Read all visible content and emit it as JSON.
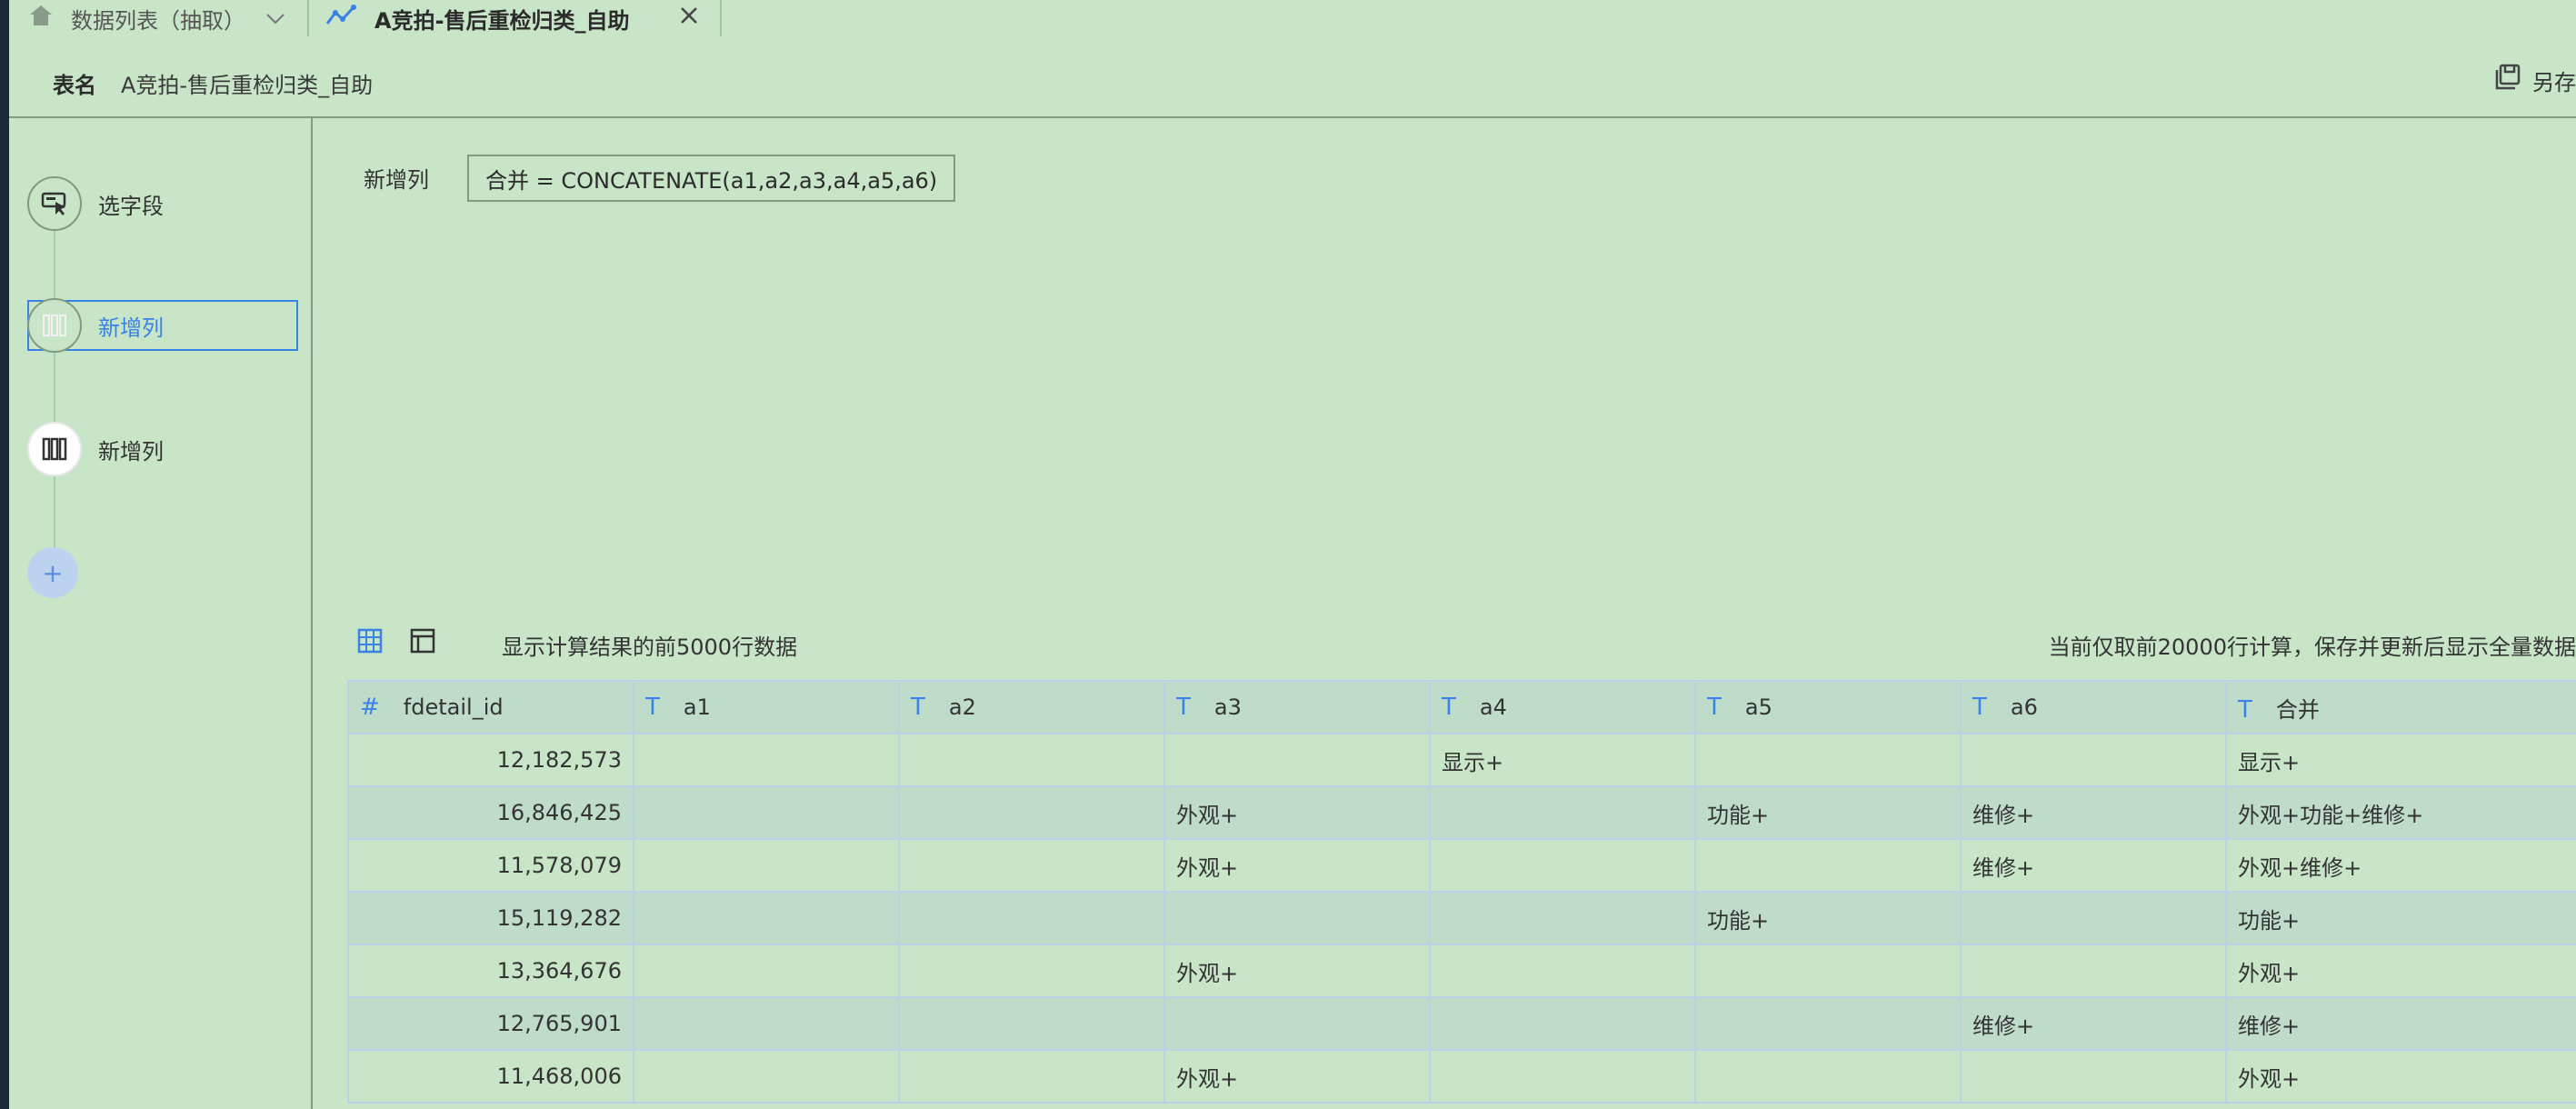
{
  "tabs": [
    {
      "label": "数据列表（抽取）",
      "icon": "home-icon"
    },
    {
      "label": "A竞拍-售后重检归类_自助",
      "icon": "line-chart-icon"
    }
  ],
  "header": {
    "table_name_label": "表名",
    "table_name": "A竞拍-售后重检归类_自助",
    "save_as_label": "另存"
  },
  "steps": [
    {
      "label": "选字段",
      "icon": "select-field-icon"
    },
    {
      "label": "新增列",
      "icon": "add-column-icon",
      "active": true
    },
    {
      "label": "新增列",
      "icon": "add-column-icon"
    }
  ],
  "formula": {
    "label": "新增列",
    "expression": "合并 = CONCATENATE(a1,a2,a3,a4,a5,a6)"
  },
  "preview": {
    "left_text": "显示计算结果的前5000行数据",
    "right_text": "当前仅取前20000行计算，保存并更新后显示全量数据"
  },
  "table": {
    "columns": [
      {
        "name": "fdetail_id",
        "type": "#"
      },
      {
        "name": "a1",
        "type": "T"
      },
      {
        "name": "a2",
        "type": "T"
      },
      {
        "name": "a3",
        "type": "T"
      },
      {
        "name": "a4",
        "type": "T"
      },
      {
        "name": "a5",
        "type": "T"
      },
      {
        "name": "a6",
        "type": "T"
      },
      {
        "name": "合并",
        "type": "T"
      }
    ],
    "rows": [
      [
        "12,182,573",
        "",
        "",
        "",
        "显示+",
        "",
        "",
        "显示+"
      ],
      [
        "16,846,425",
        "",
        "",
        "外观+",
        "",
        "功能+",
        "维修+",
        "外观+功能+维修+"
      ],
      [
        "11,578,079",
        "",
        "",
        "外观+",
        "",
        "",
        "维修+",
        "外观+维修+"
      ],
      [
        "15,119,282",
        "",
        "",
        "",
        "",
        "功能+",
        "",
        "功能+"
      ],
      [
        "13,364,676",
        "",
        "",
        "外观+",
        "",
        "",
        "",
        "外观+"
      ],
      [
        "12,765,901",
        "",
        "",
        "",
        "",
        "",
        "维修+",
        "维修+"
      ],
      [
        "11,468,006",
        "",
        "",
        "外观+",
        "",
        "",
        "",
        "外观+"
      ]
    ]
  },
  "colors": {
    "accent": "#3b82e6",
    "background": "#c8e5c8"
  }
}
